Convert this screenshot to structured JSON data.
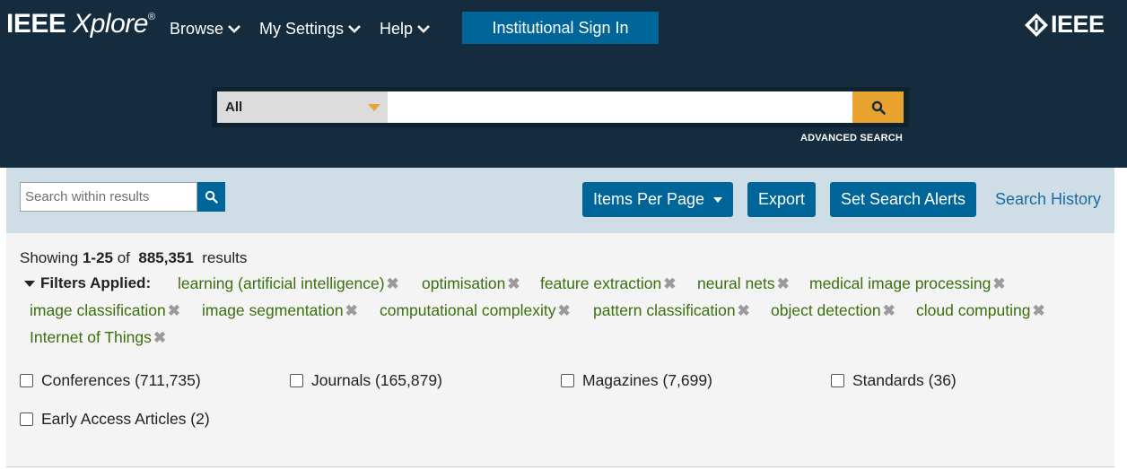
{
  "header": {
    "brand_main": "IEEE",
    "brand_italic": "Xplore",
    "brand_reg": "®",
    "nav": [
      {
        "label": "Browse"
      },
      {
        "label": "My Settings"
      },
      {
        "label": "Help"
      }
    ],
    "signin_label": "Institutional Sign In",
    "logo_text": "IEEE"
  },
  "search": {
    "scope": "All",
    "value": "",
    "placeholder": "",
    "advanced_label": "ADVANCED SEARCH"
  },
  "toolbar": {
    "within_placeholder": "Search within results",
    "items_per_page_label": "Items Per Page",
    "export_label": "Export",
    "alerts_label": "Set Search Alerts",
    "history_label": "Search History"
  },
  "results": {
    "showing_prefix": "Showing",
    "range": "1-25",
    "of": "of",
    "total": "885,351",
    "suffix": "results",
    "filters_label": "Filters Applied:",
    "filters": [
      "learning (artificial intelligence)",
      "optimisation",
      "feature extraction",
      "neural nets",
      "medical image processing",
      "image classification",
      "image segmentation",
      "computational complexity",
      "pattern classification",
      "object detection",
      "cloud computing",
      "Internet of Things"
    ],
    "remove_glyph": "✖",
    "content_types": [
      {
        "label": "Conferences (711,735)",
        "checked": false
      },
      {
        "label": "Journals (165,879)",
        "checked": false
      },
      {
        "label": "Magazines (7,699)",
        "checked": false
      },
      {
        "label": "Standards (36)",
        "checked": false
      },
      {
        "label": "Early Access Articles (2)",
        "checked": false
      }
    ]
  },
  "colors": {
    "header_bg": "#142c3d",
    "accent_blue": "#006699",
    "search_orange": "#e8a22e",
    "filter_green": "#3a6f0d",
    "toolbar_bg": "#cfdee6"
  }
}
